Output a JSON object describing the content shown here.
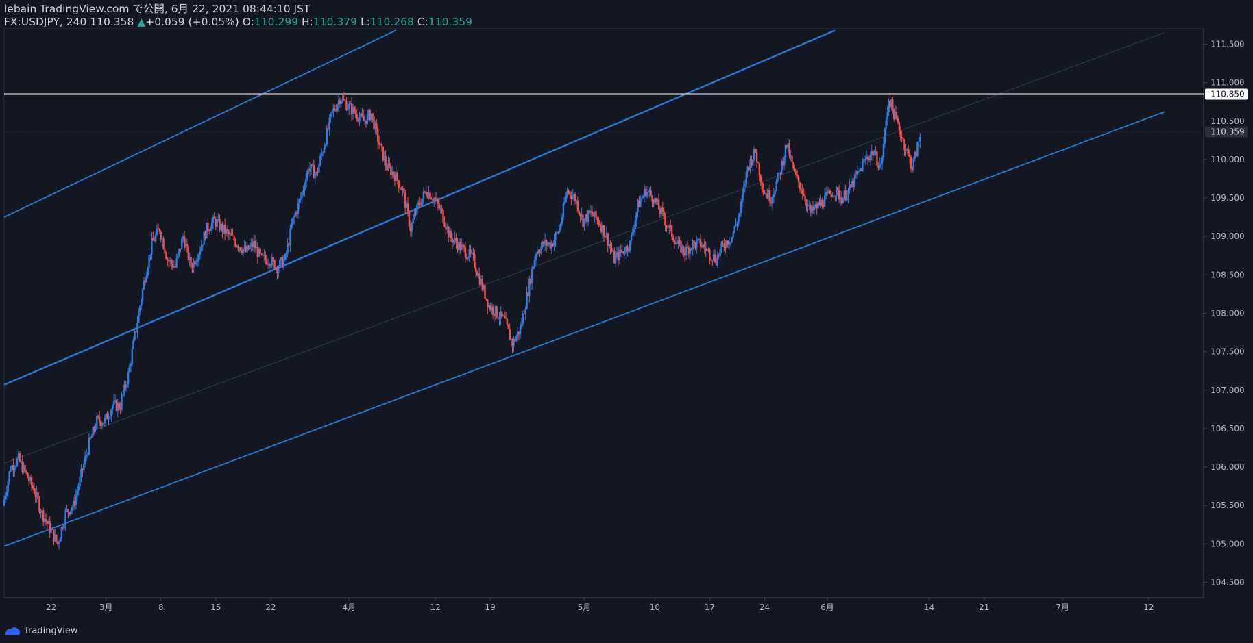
{
  "header": {
    "publish_line": "lebain TradingView.com で公開, 6月 22, 2021 08:44:10 JST",
    "symbol_line": "FX:USDJPY, 240 110.358",
    "change_arrow": "▲",
    "change_text": "+0.059 (+0.05%)",
    "o_label": "O:",
    "o_value": "110.299",
    "h_label": "H:",
    "h_value": "110.379",
    "l_label": "L:",
    "l_value": "110.268",
    "c_label": "C:",
    "c_value": "110.359"
  },
  "footer": {
    "brand": "TradingView"
  },
  "colors": {
    "background": "#131722",
    "up": "#2f7ee0",
    "down": "#ef5350",
    "channel": "#2a7ad4",
    "resistance": "#ffffff",
    "axis_text": "#b2b5be",
    "change_up": "#26a69a",
    "grid_line": "#363a45"
  },
  "chart_data": {
    "type": "candlestick",
    "symbol": "FX:USDJPY",
    "interval": "240",
    "y_ticks": [
      "111.500",
      "111.000",
      "110.500",
      "110.000",
      "109.500",
      "109.000",
      "108.500",
      "108.000",
      "107.500",
      "107.000",
      "106.500",
      "106.000",
      "105.500",
      "105.000",
      "104.500"
    ],
    "y_range": [
      104.3,
      111.7
    ],
    "x_ticks": [
      {
        "label": "22",
        "day": -7
      },
      {
        "label": "3月",
        "day": 0
      },
      {
        "label": "8",
        "day": 7
      },
      {
        "label": "15",
        "day": 14
      },
      {
        "label": "22",
        "day": 21
      },
      {
        "label": "4月",
        "day": 31
      },
      {
        "label": "12",
        "day": 42
      },
      {
        "label": "19",
        "day": 49
      },
      {
        "label": "5月",
        "day": 61
      },
      {
        "label": "10",
        "day": 70
      },
      {
        "label": "17",
        "day": 77
      },
      {
        "label": "24",
        "day": 84
      },
      {
        "label": "6月",
        "day": 92
      },
      {
        "label": "14",
        "day": 105
      },
      {
        "label": "21",
        "day": 112
      },
      {
        "label": "7月",
        "day": 122
      },
      {
        "label": "12",
        "day": 133
      }
    ],
    "x_range_days": [
      -13,
      140
    ],
    "price_markers": [
      {
        "label": "110.850",
        "value": 110.85,
        "style": "boxed-white"
      },
      {
        "label": "110.359",
        "value": 110.359,
        "style": "last-price"
      }
    ],
    "resistance_level": 110.85,
    "channel_lines": [
      {
        "name": "upper",
        "d1": -13,
        "p1": 109.25,
        "d2": 37,
        "p2": 111.68
      },
      {
        "name": "middle",
        "d1": -13,
        "p1": 107.07,
        "d2": 93,
        "p2": 111.68
      },
      {
        "name": "lower",
        "d1": -13,
        "p1": 104.97,
        "d2": 135,
        "p2": 110.62
      },
      {
        "name": "mid-faint",
        "d1": -13,
        "p1": 106.05,
        "d2": 135,
        "p2": 111.65
      }
    ],
    "path_points": [
      [
        -13,
        105.5
      ],
      [
        -12,
        106.0
      ],
      [
        -11,
        106.1
      ],
      [
        -10,
        105.9
      ],
      [
        -9,
        105.7
      ],
      [
        -8,
        105.4
      ],
      [
        -7,
        105.2
      ],
      [
        -6,
        105.0
      ],
      [
        -5,
        105.4
      ],
      [
        -4,
        105.5
      ],
      [
        -3,
        105.9
      ],
      [
        -2,
        106.3
      ],
      [
        -1,
        106.6
      ],
      [
        0,
        106.6
      ],
      [
        1,
        106.8
      ],
      [
        2,
        106.8
      ],
      [
        3,
        107.2
      ],
      [
        4,
        107.8
      ],
      [
        5,
        108.4
      ],
      [
        6,
        108.9
      ],
      [
        7,
        109.1
      ],
      [
        8,
        108.7
      ],
      [
        9,
        108.6
      ],
      [
        10,
        109.0
      ],
      [
        11,
        108.6
      ],
      [
        12,
        108.8
      ],
      [
        13,
        109.1
      ],
      [
        14,
        109.2
      ],
      [
        15,
        109.1
      ],
      [
        16,
        109.0
      ],
      [
        17,
        108.9
      ],
      [
        18,
        108.8
      ],
      [
        19,
        108.9
      ],
      [
        20,
        108.7
      ],
      [
        21,
        108.7
      ],
      [
        22,
        108.6
      ],
      [
        23,
        108.7
      ],
      [
        24,
        109.2
      ],
      [
        25,
        109.5
      ],
      [
        26,
        109.9
      ],
      [
        27,
        109.8
      ],
      [
        28,
        110.2
      ],
      [
        29,
        110.6
      ],
      [
        30,
        110.8
      ],
      [
        31,
        110.7
      ],
      [
        32,
        110.6
      ],
      [
        33,
        110.5
      ],
      [
        34,
        110.6
      ],
      [
        35,
        110.2
      ],
      [
        36,
        109.9
      ],
      [
        37,
        109.8
      ],
      [
        38,
        109.6
      ],
      [
        39,
        109.1
      ],
      [
        40,
        109.4
      ],
      [
        41,
        109.6
      ],
      [
        42,
        109.5
      ],
      [
        43,
        109.3
      ],
      [
        44,
        109.0
      ],
      [
        45,
        108.9
      ],
      [
        46,
        108.8
      ],
      [
        47,
        108.7
      ],
      [
        48,
        108.4
      ],
      [
        49,
        108.1
      ],
      [
        50,
        108.0
      ],
      [
        51,
        107.9
      ],
      [
        52,
        107.6
      ],
      [
        53,
        107.8
      ],
      [
        54,
        108.3
      ],
      [
        55,
        108.8
      ],
      [
        56,
        108.9
      ],
      [
        57,
        108.9
      ],
      [
        58,
        109.1
      ],
      [
        59,
        109.6
      ],
      [
        60,
        109.5
      ],
      [
        61,
        109.2
      ],
      [
        62,
        109.3
      ],
      [
        63,
        109.2
      ],
      [
        64,
        109.0
      ],
      [
        65,
        108.7
      ],
      [
        66,
        108.8
      ],
      [
        67,
        108.9
      ],
      [
        68,
        109.4
      ],
      [
        69,
        109.6
      ],
      [
        70,
        109.5
      ],
      [
        71,
        109.3
      ],
      [
        72,
        109.1
      ],
      [
        73,
        108.9
      ],
      [
        74,
        108.8
      ],
      [
        75,
        108.9
      ],
      [
        76,
        108.9
      ],
      [
        77,
        108.8
      ],
      [
        78,
        108.7
      ],
      [
        79,
        108.9
      ],
      [
        80,
        109.0
      ],
      [
        81,
        109.3
      ],
      [
        82,
        109.9
      ],
      [
        83,
        110.1
      ],
      [
        84,
        109.6
      ],
      [
        85,
        109.5
      ],
      [
        86,
        109.8
      ],
      [
        87,
        110.2
      ],
      [
        88,
        109.8
      ],
      [
        89,
        109.6
      ],
      [
        90,
        109.3
      ],
      [
        91,
        109.4
      ],
      [
        92,
        109.5
      ],
      [
        93,
        109.6
      ],
      [
        94,
        109.5
      ],
      [
        95,
        109.6
      ],
      [
        96,
        109.8
      ],
      [
        97,
        110.0
      ],
      [
        98,
        110.1
      ],
      [
        99,
        109.9
      ],
      [
        100,
        110.8
      ],
      [
        101,
        110.5
      ],
      [
        102,
        110.2
      ],
      [
        103,
        109.9
      ],
      [
        104,
        110.3
      ]
    ]
  }
}
